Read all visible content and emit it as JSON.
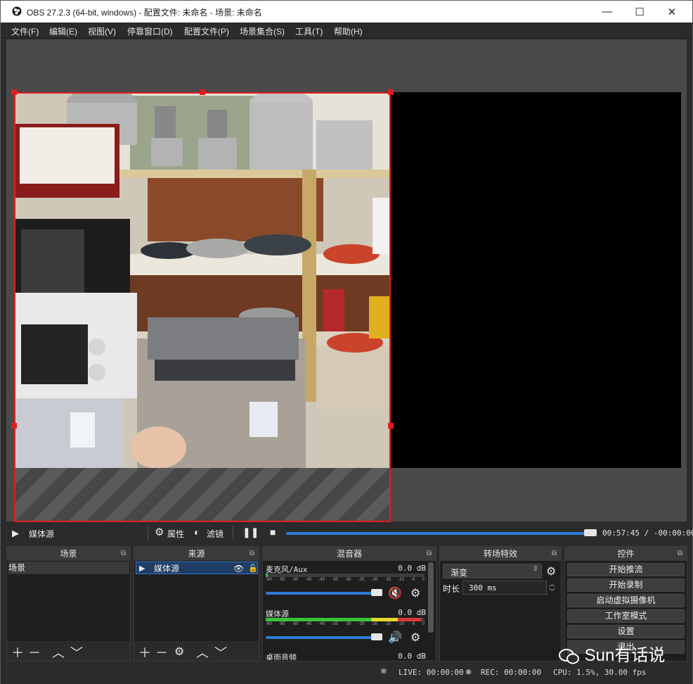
{
  "window": {
    "title": "OBS 27.2.3 (64-bit, windows) - 配置文件: 未命名 - 场景: 未命名",
    "minimize_glyph": "—",
    "maximize_glyph": "☐",
    "close_glyph": "✕"
  },
  "menu": [
    "文件(F)",
    "编辑(E)",
    "视图(V)",
    "停靠窗口(D)",
    "配置文件(P)",
    "场景集合(S)",
    "工具(T)",
    "帮助(H)"
  ],
  "media_controls": {
    "source_name": "媒体源",
    "properties_label": "属性",
    "filters_label": "滤镜",
    "progress": 0.97,
    "time_display": "00:57:45 / -00:00:00"
  },
  "docks": {
    "scenes": {
      "title": "场景",
      "items": [
        "场景"
      ]
    },
    "sources": {
      "title": "来源",
      "items": [
        "媒体源"
      ]
    },
    "mixer": {
      "title": "混音器",
      "scale_ticks": [
        "-60",
        "-55",
        "-50",
        "-45",
        "-40",
        "-35",
        "-30",
        "-25",
        "-20",
        "-15",
        "-10",
        "-5",
        "0"
      ],
      "channels": [
        {
          "name": "麦克风/Aux",
          "db": "0.0 dB",
          "muted": true,
          "level": 0
        },
        {
          "name": "媒体源",
          "db": "0.0 dB",
          "muted": false,
          "level": 0.9
        },
        {
          "name": "桌面音频",
          "db": "0.0 dB",
          "muted": false,
          "level": 0
        }
      ]
    },
    "transitions": {
      "title": "转场特效",
      "selected": "渐变",
      "duration_label": "时长",
      "duration_value": "300 ms"
    },
    "controls": {
      "title": "控件",
      "buttons": [
        "开始推流",
        "开始录制",
        "启动虚拟摄像机",
        "工作室模式",
        "设置",
        "退出"
      ]
    }
  },
  "status": {
    "live": "LIVE: 00:00:00",
    "rec": "REC: 00:00:00",
    "cpu": "CPU: 1.5%, 30.00 fps"
  },
  "watermark": "Sun有话说",
  "colors": {
    "accent": "#2d7bd6",
    "selection": "#e01f1f",
    "mute": "#e02828"
  }
}
